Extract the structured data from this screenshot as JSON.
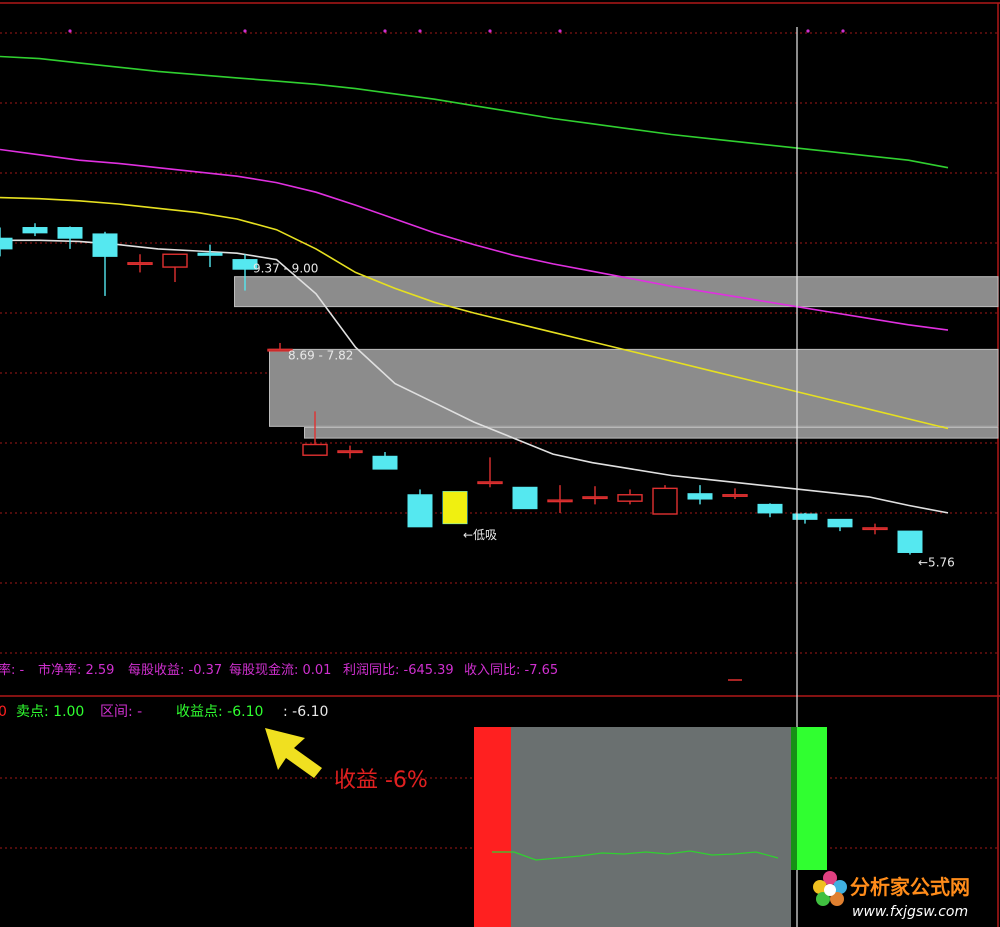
{
  "colors": {
    "background": "#000000",
    "grid": "#a01818",
    "frame": "#b01818",
    "up": "#e03030",
    "down": "#55e8f0",
    "ma_white": "#e0e0e0",
    "ma_yellow": "#e6e020",
    "ma_magenta": "#e030e0",
    "ma_green": "#30d030",
    "zone_gray": "#8c8c8c",
    "crosshair": "#e8e8e8",
    "fundamentals": "#d030d0",
    "signal_red": "#ff2020",
    "signal_green": "#30ff30",
    "signal_panel": "#6a7070",
    "annotation": "#e02020",
    "arrow": "#f0e020"
  },
  "fundamentals_row": {
    "pe": "率: -",
    "pb": "市净率: 2.59",
    "eps": "每股收益: -0.37",
    "cashflow": "每股现金流: 0.01",
    "profit_yoy": "利润同比: -645.39",
    "revenue_yoy": "收入同比: -7.65"
  },
  "indicator_row": {
    "prefix": "0",
    "sell_point": "卖点: 1.00",
    "interval": "区间: -",
    "profit_point_label": "收益点: -6.10",
    "profit_point_value": ": -6.10"
  },
  "annotation": {
    "text": "收益 -6%",
    "arrow_icon": "yellow-arrow-icon"
  },
  "watermark": {
    "name": "分析家公式网",
    "url": "www.fxjgsw.com",
    "icon": "flower-logo-icon"
  },
  "chart_data": [
    {
      "type": "candlestick",
      "title": "",
      "ylim": [
        5.4,
        11.2
      ],
      "candles": [
        {
          "o": 9.72,
          "c": 9.62,
          "h": 9.82,
          "l": 9.55
        },
        {
          "o": 9.82,
          "c": 9.77,
          "h": 9.86,
          "l": 9.74
        },
        {
          "o": 9.82,
          "c": 9.72,
          "h": 9.83,
          "l": 9.62
        },
        {
          "o": 9.76,
          "c": 9.55,
          "h": 9.78,
          "l": 9.18
        },
        {
          "o": 9.48,
          "c": 9.49,
          "h": 9.57,
          "l": 9.4
        },
        {
          "o": 9.45,
          "c": 9.57,
          "h": 9.57,
          "l": 9.31
        },
        {
          "o": 9.58,
          "c": 9.56,
          "h": 9.66,
          "l": 9.45
        },
        {
          "o": 9.52,
          "c": 9.43,
          "h": 9.57,
          "l": 9.23
        },
        {
          "o": 8.68,
          "c": 8.68,
          "h": 8.74,
          "l": 8.68
        },
        {
          "o": 7.69,
          "c": 7.79,
          "h": 8.1,
          "l": 7.69
        },
        {
          "o": 7.73,
          "c": 7.73,
          "h": 7.78,
          "l": 7.66
        },
        {
          "o": 7.68,
          "c": 7.56,
          "h": 7.72,
          "l": 7.56
        },
        {
          "o": 7.32,
          "c": 7.02,
          "h": 7.37,
          "l": 7.02
        },
        {
          "o": 7.35,
          "c": 7.05,
          "h": 7.35,
          "l": 7.05
        },
        {
          "o": 7.44,
          "c": 7.44,
          "h": 7.67,
          "l": 7.39
        },
        {
          "o": 7.39,
          "c": 7.19,
          "h": 7.39,
          "l": 7.19
        },
        {
          "o": 7.27,
          "c": 7.27,
          "h": 7.41,
          "l": 7.15
        },
        {
          "o": 7.3,
          "c": 7.3,
          "h": 7.4,
          "l": 7.23
        },
        {
          "o": 7.26,
          "c": 7.32,
          "h": 7.37,
          "l": 7.23
        },
        {
          "o": 7.14,
          "c": 7.38,
          "h": 7.41,
          "l": 7.14
        },
        {
          "o": 7.33,
          "c": 7.28,
          "h": 7.41,
          "l": 7.23
        },
        {
          "o": 7.32,
          "c": 7.32,
          "h": 7.38,
          "l": 7.28
        },
        {
          "o": 7.23,
          "c": 7.15,
          "h": 7.24,
          "l": 7.11
        },
        {
          "o": 7.14,
          "c": 7.09,
          "h": 7.15,
          "l": 7.05
        },
        {
          "o": 7.09,
          "c": 7.02,
          "h": 7.09,
          "l": 6.98
        },
        {
          "o": 7.01,
          "c": 7.01,
          "h": 7.05,
          "l": 6.95
        },
        {
          "o": 6.98,
          "c": 6.78,
          "h": 6.98,
          "l": 6.76
        }
      ],
      "candle_labels": [
        {
          "index": 7,
          "text": "9.37 - 9.00"
        },
        {
          "index": 8,
          "text": "8.69 - 7.82"
        },
        {
          "index": 13,
          "text": "←低吸"
        },
        {
          "index": 26,
          "text": "←5.76"
        }
      ],
      "zones": [
        {
          "from_index": 7,
          "to_index": 28,
          "low": 9.08,
          "high": 9.36
        },
        {
          "from_index": 8,
          "to_index": 28,
          "low": 7.96,
          "high": 8.68
        },
        {
          "from_index": 9,
          "to_index": 28,
          "low": 7.85,
          "high": 7.95
        }
      ],
      "series": [
        {
          "color": "#e0e0e0",
          "values": [
            9.7,
            9.7,
            9.69,
            9.66,
            9.62,
            9.6,
            9.58,
            9.52,
            9.2,
            8.7,
            8.36,
            8.18,
            8.0,
            7.85,
            7.7,
            7.62,
            7.56,
            7.5,
            7.46,
            7.42,
            7.38,
            7.34,
            7.3,
            7.22,
            7.15
          ]
        },
        {
          "color": "#e6e020",
          "values": [
            10.1,
            10.09,
            10.07,
            10.04,
            10.0,
            9.96,
            9.9,
            9.8,
            9.62,
            9.4,
            9.25,
            9.12,
            9.02,
            8.93,
            8.84,
            8.75,
            8.66,
            8.57,
            8.48,
            8.39,
            8.3,
            8.21,
            8.12,
            8.03,
            7.94
          ]
        },
        {
          "color": "#e030e0",
          "values": [
            10.55,
            10.5,
            10.45,
            10.42,
            10.38,
            10.34,
            10.3,
            10.24,
            10.15,
            10.03,
            9.9,
            9.77,
            9.66,
            9.56,
            9.48,
            9.41,
            9.34,
            9.27,
            9.21,
            9.15,
            9.09,
            9.03,
            8.97,
            8.91,
            8.86
          ]
        },
        {
          "color": "#30d030",
          "values": [
            11.42,
            11.4,
            11.36,
            11.32,
            11.28,
            11.25,
            11.22,
            11.19,
            11.16,
            11.12,
            11.07,
            11.02,
            10.96,
            10.9,
            10.84,
            10.79,
            10.74,
            10.69,
            10.65,
            10.61,
            10.57,
            10.53,
            10.49,
            10.45,
            10.38
          ]
        }
      ]
    },
    {
      "type": "area",
      "title": "",
      "sub_line": [
        0.5,
        0.5,
        0.1,
        0.2,
        0.3,
        0.45,
        0.4,
        0.5,
        0.4,
        0.55,
        0.35,
        0.4,
        0.5,
        0.2
      ]
    }
  ]
}
